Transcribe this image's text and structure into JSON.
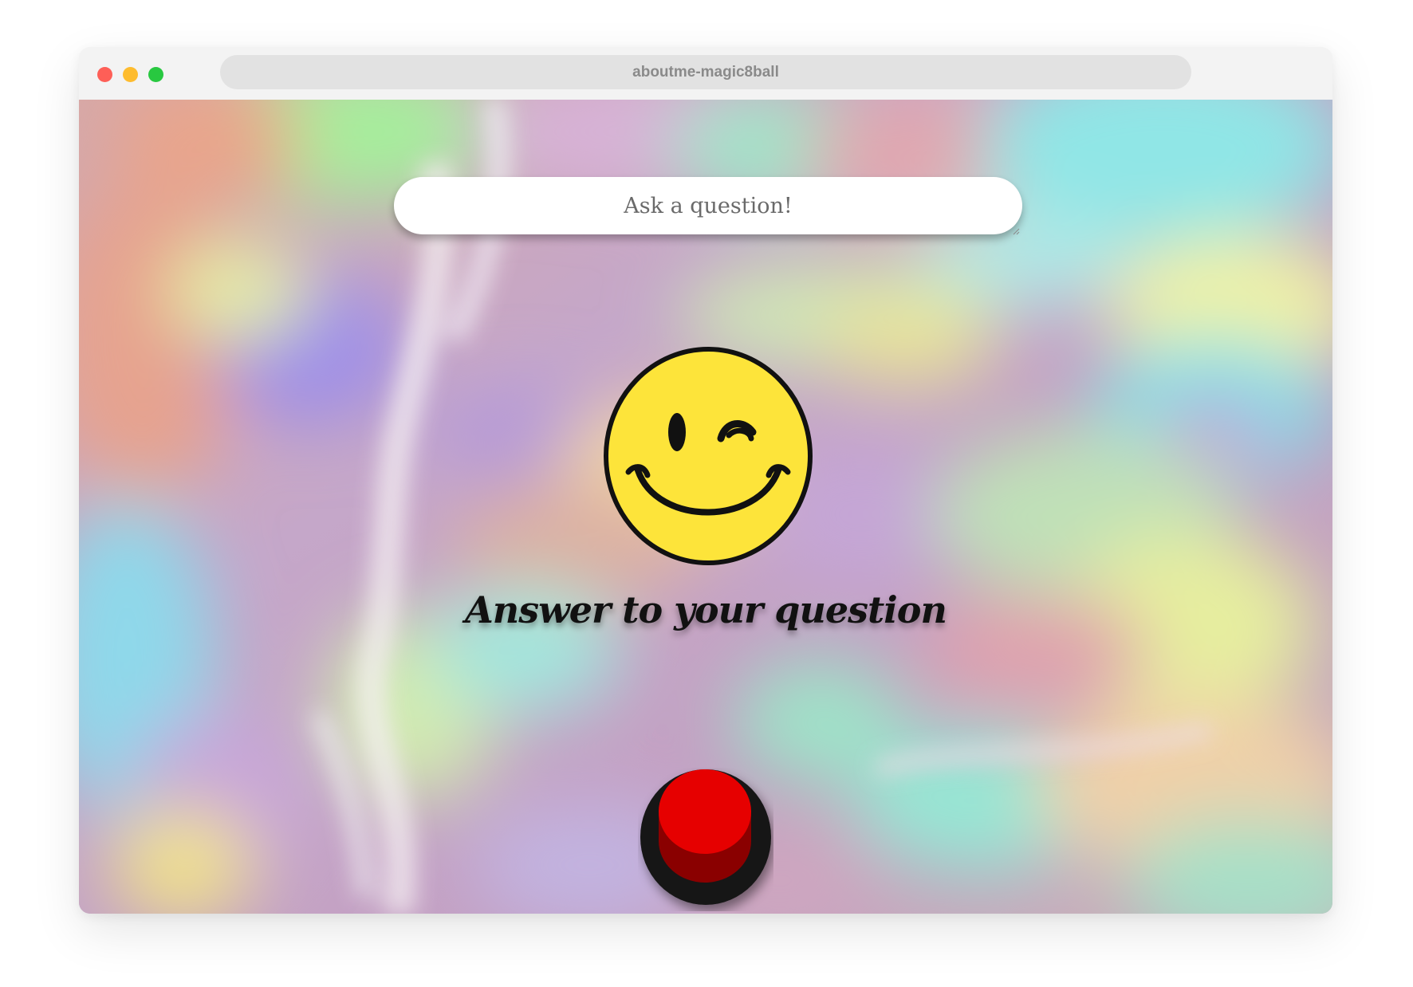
{
  "window": {
    "url": "aboutme-magic8ball"
  },
  "traffic_lights": {
    "close_color": "#fe5f57",
    "minimize_color": "#febc2e",
    "maximize_color": "#28c840"
  },
  "question": {
    "placeholder": "Ask a question!",
    "value": ""
  },
  "emoji": {
    "icon": "winking-face-icon",
    "face_color": "#fde43a",
    "outline_color": "#111111"
  },
  "answer": {
    "text": "Answer to your question"
  },
  "shake_button": {
    "icon": "red-push-button-icon",
    "cap_color": "#e60000",
    "base_color": "#141414"
  }
}
